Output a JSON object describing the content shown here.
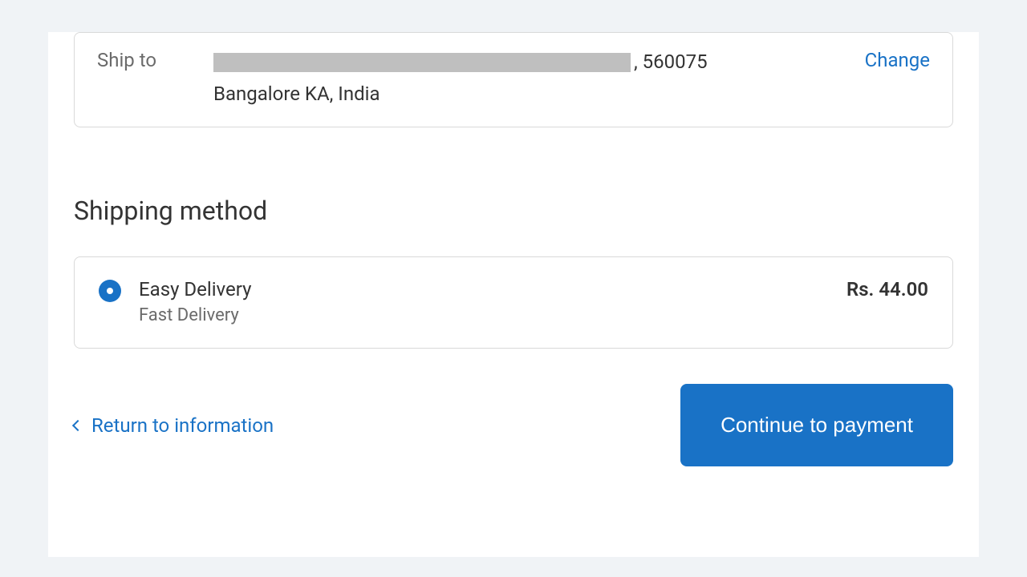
{
  "review": {
    "ship_to_label": "Ship to",
    "postal": ", 560075",
    "city_line": "Bangalore KA, India",
    "change_label": "Change"
  },
  "shipping": {
    "heading": "Shipping method",
    "option": {
      "title": "Easy Delivery",
      "subtitle": "Fast Delivery",
      "price": "Rs. 44.00"
    }
  },
  "footer": {
    "return_label": "Return to information",
    "continue_label": "Continue to payment"
  }
}
